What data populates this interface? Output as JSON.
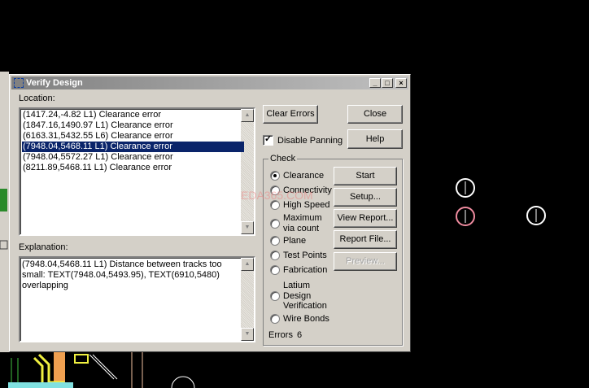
{
  "dialog": {
    "title": "Verify Design",
    "location_label": "Location:",
    "explanation_label": "Explanation:",
    "locations": [
      "(1417.24,-4.82 L1) Clearance error",
      "(1847.16,1490.97 L1) Clearance error",
      "(6163.31,5432.55 L6) Clearance error",
      "(7948.04,5468.11 L1) Clearance error",
      "(7948.04,5572.27 L1) Clearance error",
      "(8211.89,5468.11 L1) Clearance error"
    ],
    "selected_index": 3,
    "explanation": "(7948.04,5468.11 L1) Distance between tracks too small: TEXT(7948.04,5493.95), TEXT(6910,5480) overlapping",
    "buttons": {
      "clear_errors": "Clear Errors",
      "close": "Close",
      "help": "Help",
      "start": "Start",
      "setup": "Setup...",
      "view_report": "View Report...",
      "report_file": "Report File...",
      "preview": "Preview..."
    },
    "disable_panning": {
      "label": "Disable Panning",
      "checked": true
    },
    "check": {
      "label": "Check",
      "options": [
        "Clearance",
        "Connectivity",
        "High Speed",
        "Maximum via count",
        "Plane",
        "Test Points",
        "Fabrication",
        "Latium Design Verification",
        "Wire Bonds"
      ],
      "selected": "Clearance"
    },
    "errors_label": "Errors",
    "errors_count": "6"
  },
  "watermark": "EDA365.COM",
  "colors": {
    "selection": "#0a246a",
    "face": "#d4d0c8"
  }
}
